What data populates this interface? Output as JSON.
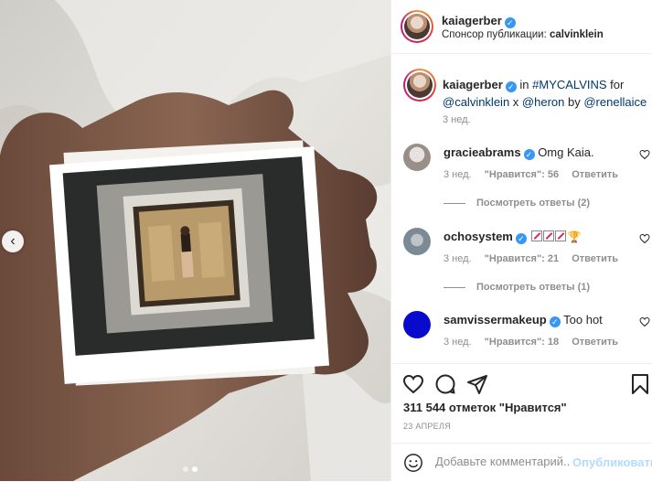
{
  "header": {
    "username": "kaiagerber",
    "sponsor_label": "Спонсор публикации:",
    "sponsor_name": "calvinklein"
  },
  "caption": {
    "username": "kaiagerber",
    "in_text": "in",
    "hashtag": "#MYCALVINS",
    "for_text": "for",
    "mention1": "@calvinklein",
    "x_text": "x",
    "mention2": "@heron",
    "by_text": "by",
    "mention3": "@renellaice",
    "time": "3 нед."
  },
  "comments": [
    {
      "username": "gracieabrams",
      "text": "Omg Kaia.",
      "time": "3 нед.",
      "likes": "\"Нравится\": 56",
      "reply": "Ответить",
      "view_replies": "Посмотреть ответы (2)"
    },
    {
      "username": "ochosystem",
      "text": "",
      "emoji_count": 3,
      "time": "3 нед.",
      "likes": "\"Нравится\": 21",
      "reply": "Ответить",
      "view_replies": "Посмотреть ответы (1)"
    },
    {
      "username": "samvissermakeup",
      "text": "Too hot",
      "time": "3 нед.",
      "likes": "\"Нравится\": 18",
      "reply": "Ответить"
    }
  ],
  "likes_count": "311 544 отметок \"Нравится\"",
  "date": "23 АПРЕЛЯ",
  "add_comment": {
    "placeholder": "Добавьте комментарий...",
    "publish_label": "Опубликовать"
  },
  "colors": {
    "link": "#00376b",
    "verified": "#3897f0",
    "publish_disabled": "#b3dbff"
  },
  "icons": {
    "like": "heart-icon",
    "comment": "comment-icon",
    "share": "send-icon",
    "save": "bookmark-icon",
    "emoji": "smile-icon",
    "prev": "chevron-left-icon"
  },
  "carousel": {
    "slides": 2,
    "active": 2
  }
}
